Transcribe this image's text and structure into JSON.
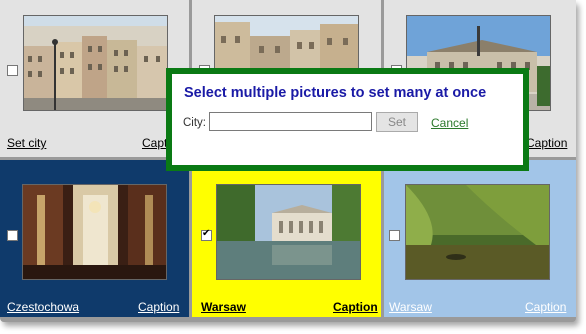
{
  "dialog": {
    "title": "Select multiple pictures to set many at once",
    "city_label": "City:",
    "city_value": "",
    "set_label": "Set",
    "cancel_label": "Cancel"
  },
  "cells": [
    {
      "label": "Set city",
      "caption": "Caption",
      "checked": false,
      "photo": "city-street-photo"
    },
    {
      "label": "",
      "caption": "",
      "checked": false,
      "photo": "old-town-street-photo"
    },
    {
      "label": "",
      "caption": "Caption",
      "checked": false,
      "photo": "palace-square-photo"
    },
    {
      "label": "Czestochowa",
      "caption": "Caption",
      "checked": false,
      "photo": "church-interior-photo"
    },
    {
      "label": "Warsaw",
      "caption": "Caption",
      "checked": true,
      "photo": "palace-on-water-photo"
    },
    {
      "label": "Warsaw",
      "caption": "Caption",
      "checked": false,
      "photo": "pond-willow-photo"
    }
  ],
  "colors": {
    "dialog_border": "#0a7a14",
    "dialog_title": "#1a1aa6",
    "cell_dark_blue": "#0f3a6b",
    "cell_yellow": "#ffff00",
    "cell_light_blue": "#a2c5e8",
    "cell_grey": "#e3e3e3"
  }
}
